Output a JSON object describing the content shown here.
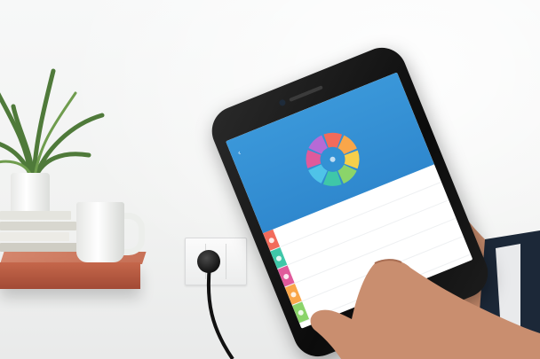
{
  "scene": {
    "description_free": true,
    "colors": {
      "wall": "#f3f4f3",
      "shelf": "#b4583f",
      "app_header": "#3391d4",
      "wheel_segments": [
        "#f26b5b",
        "#f9a64a",
        "#f6cf4a",
        "#8bd46a",
        "#3fc7a8",
        "#4fc3e8",
        "#e05a9b",
        "#b66ad6"
      ],
      "row_stripes": [
        "#f26b5b",
        "#3fc7a8",
        "#e05a9b",
        "#f9a64a",
        "#8bd46a"
      ]
    }
  },
  "phone_app": {
    "status_bar": {
      "left": "",
      "right": ""
    },
    "title": "",
    "icons": [
      "back-icon",
      "color-wheel-icon",
      "plug-icon"
    ],
    "devices": [
      {
        "label": "",
        "value": ""
      },
      {
        "label": "",
        "value": ""
      },
      {
        "label": "",
        "value": ""
      },
      {
        "label": "",
        "value": ""
      },
      {
        "label": "",
        "value": ""
      }
    ]
  }
}
